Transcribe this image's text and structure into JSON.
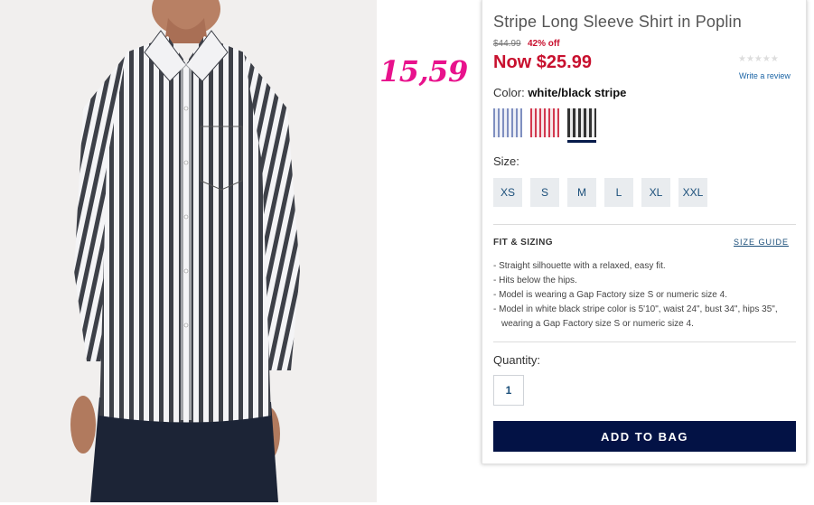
{
  "annotation": {
    "handwritten_price": "15,59"
  },
  "product": {
    "title": "Stripe Long Sleeve Shirt in Poplin",
    "original_price": "$44.99",
    "discount": "42% off",
    "now_price": "Now $25.99",
    "rating_stars": "★★★★★",
    "review_link": "Write a review",
    "sale_color": "#c8102e"
  },
  "color": {
    "label": "Color:",
    "selected": "white/black stripe",
    "swatches": [
      {
        "name": "blue stripe",
        "stripe": "#7f8fc0"
      },
      {
        "name": "red stripe",
        "stripe": "#d2394f"
      },
      {
        "name": "white/black stripe",
        "stripe": "#333333",
        "selected": true
      }
    ]
  },
  "size": {
    "label": "Size:",
    "options": [
      "XS",
      "S",
      "M",
      "L",
      "XL",
      "XXL"
    ]
  },
  "fit": {
    "title": "FIT & SIZING",
    "guide_link": "SIZE GUIDE",
    "bullets": [
      "Straight silhouette with a relaxed, easy fit.",
      "Hits below the hips.",
      "Model is wearing a Gap Factory size S or numeric size 4.",
      "Model in white black stripe color is 5'10\", waist 24\", bust 34\", hips 35\", wearing a Gap Factory size S or numeric size 4."
    ]
  },
  "quantity": {
    "label": "Quantity:",
    "value": "1"
  },
  "cta": {
    "label": "ADD TO BAG",
    "color": "#031245"
  }
}
